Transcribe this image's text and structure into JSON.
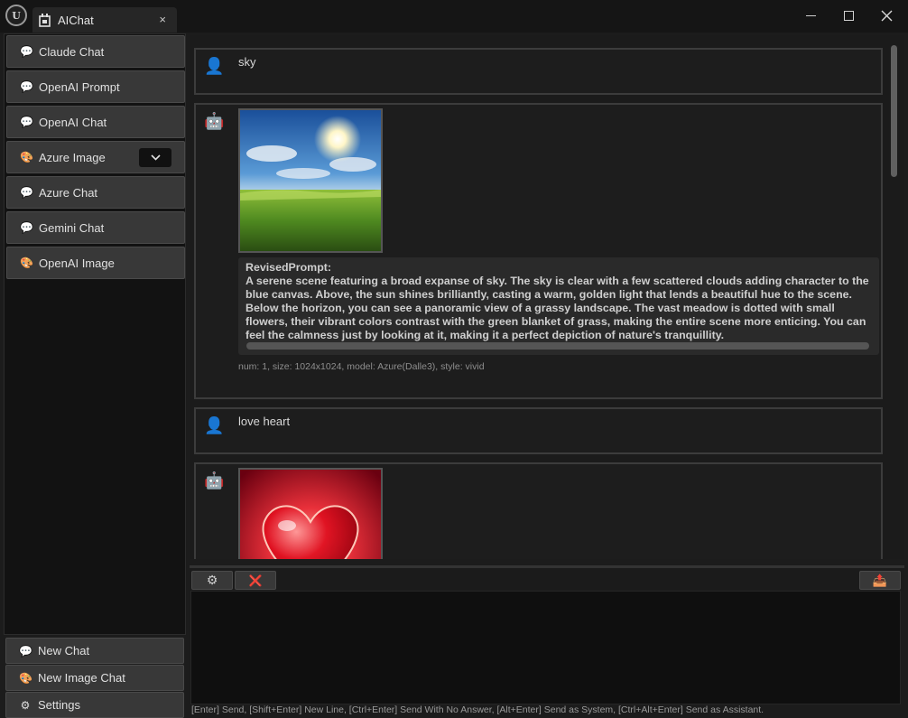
{
  "window": {
    "logo_text": "U",
    "tab_title": "AIChat",
    "tab_close": "×",
    "close_glyph": "✕"
  },
  "sidebar": {
    "items": [
      {
        "icon": "speech-bubble-icon",
        "glyph": "💬",
        "label": "Claude Chat"
      },
      {
        "icon": "speech-bubble-icon",
        "glyph": "💬",
        "label": "OpenAI Prompt"
      },
      {
        "icon": "speech-bubble-icon",
        "glyph": "💬",
        "label": "OpenAI Chat"
      },
      {
        "icon": "palette-icon",
        "glyph": "🎨",
        "label": "Azure Image"
      },
      {
        "icon": "speech-bubble-icon",
        "glyph": "💬",
        "label": "Azure Chat"
      },
      {
        "icon": "speech-bubble-icon",
        "glyph": "💬",
        "label": "Gemini Chat"
      },
      {
        "icon": "palette-icon",
        "glyph": "🎨",
        "label": "OpenAI Image"
      }
    ],
    "bottom": [
      {
        "icon": "speech-bubble-icon",
        "glyph": "💬",
        "label": "New Chat"
      },
      {
        "icon": "palette-icon",
        "glyph": "🎨",
        "label": "New Image Chat"
      },
      {
        "icon": "gear-icon",
        "glyph": "⚙",
        "label": "Settings"
      }
    ]
  },
  "chat": {
    "messages": [
      {
        "role": "user",
        "avatar": "👤",
        "text": "sky"
      },
      {
        "role": "assistant",
        "avatar": "🤖",
        "revised_prompt_label": "RevisedPrompt:",
        "revised_prompt": "A serene scene featuring a broad expanse of sky. The sky is clear with a few scattered clouds adding character to the blue canvas. Above, the sun shines brilliantly, casting a warm, golden light that lends a beautiful hue to the scene. Below the horizon, you can see a panoramic view of a grassy landscape. The vast meadow is dotted with small flowers, their vibrant colors contrast with the green blanket of grass, making the entire scene more enticing. You can feel the calmness just by looking at it, making it a perfect depiction of nature's tranquillity.",
        "meta": "num: 1, size: 1024x1024, model: Azure(Dalle3), style: vivid"
      },
      {
        "role": "user",
        "avatar": "👤",
        "text": "love heart"
      },
      {
        "role": "assistant",
        "avatar": "🤖"
      }
    ]
  },
  "toolbar": {
    "settings_glyph": "⚙",
    "clear_glyph": "❌",
    "export_glyph": "📤"
  },
  "input": {
    "value": "",
    "hint": "[Enter] Send, [Shift+Enter] New Line, [Ctrl+Enter] Send With No Answer, [Alt+Enter] Send as System, [Ctrl+Alt+Enter] Send as Assistant."
  }
}
